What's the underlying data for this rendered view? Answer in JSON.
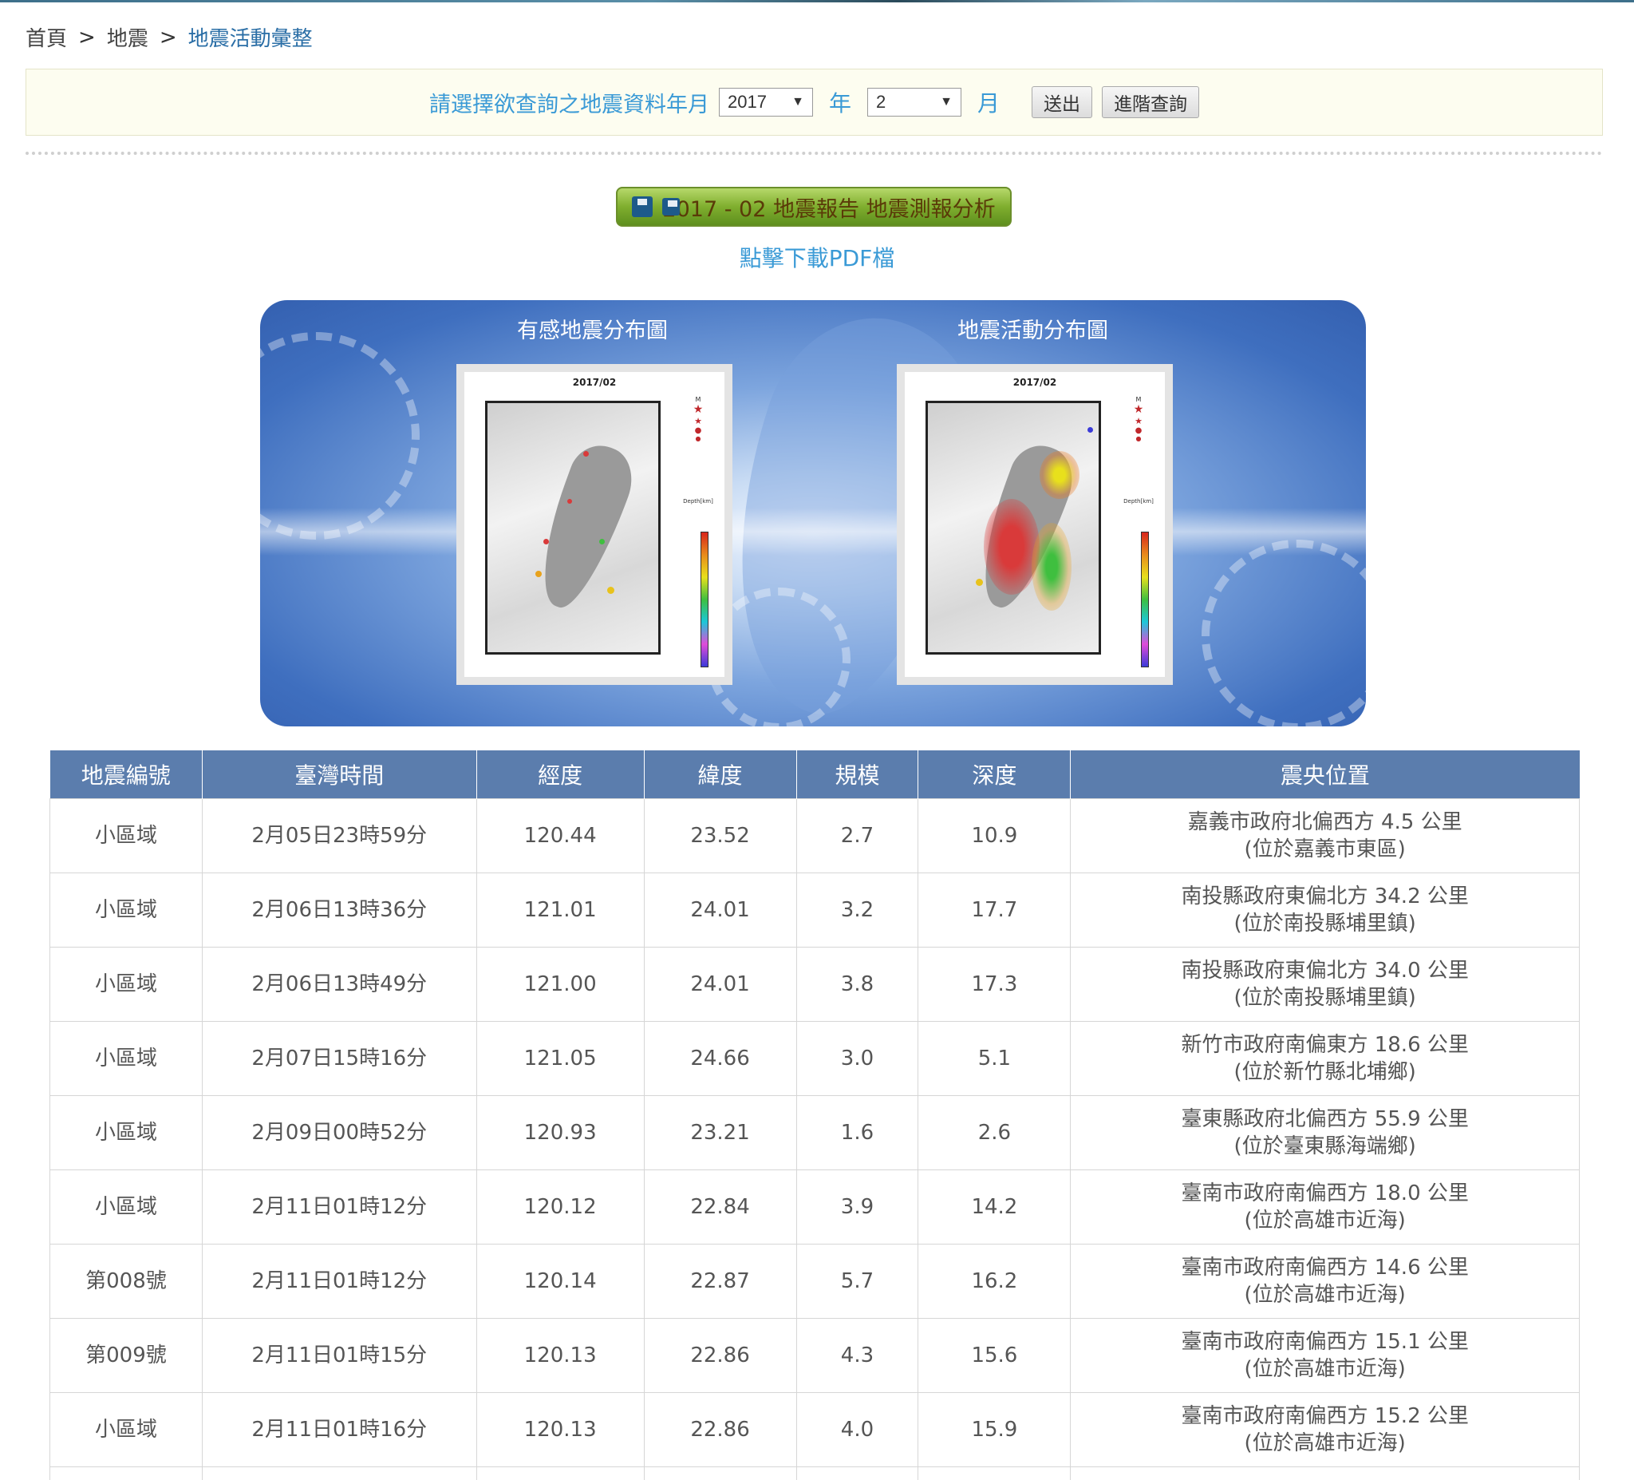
{
  "breadcrumb": {
    "home": "首頁",
    "separator": ">",
    "section": "地震",
    "current": "地震活動彙整"
  },
  "query": {
    "prompt": "請選擇欲查詢之地震資料年月",
    "year_value": "2017",
    "year_unit": "年",
    "month_value": "2",
    "month_unit": "月",
    "submit_label": "送出",
    "advanced_label": "進階查詢"
  },
  "report": {
    "button_label": "2017 - 02 地震報告 地震測報分析",
    "pdf_link": "點擊下載PDF檔"
  },
  "banner": {
    "left_title": "有感地震分布圖",
    "right_title": "地震活動分布圖",
    "left_map_date": "2017/02",
    "right_map_date": "2017/02",
    "legend_title": "M",
    "depth_label": "Depth[km]"
  },
  "table": {
    "headers": [
      "地震編號",
      "臺灣時間",
      "經度",
      "緯度",
      "規模",
      "深度",
      "震央位置"
    ],
    "rows": [
      {
        "id": "小區域",
        "time": "2月05日23時59分",
        "lon": "120.44",
        "lat": "23.52",
        "mag": "2.7",
        "depth": "10.9",
        "loc1": "嘉義市政府北偏西方 4.5 公里",
        "loc2": "(位於嘉義市東區)"
      },
      {
        "id": "小區域",
        "time": "2月06日13時36分",
        "lon": "121.01",
        "lat": "24.01",
        "mag": "3.2",
        "depth": "17.7",
        "loc1": "南投縣政府東偏北方 34.2 公里",
        "loc2": "(位於南投縣埔里鎮)"
      },
      {
        "id": "小區域",
        "time": "2月06日13時49分",
        "lon": "121.00",
        "lat": "24.01",
        "mag": "3.8",
        "depth": "17.3",
        "loc1": "南投縣政府東偏北方 34.0 公里",
        "loc2": "(位於南投縣埔里鎮)"
      },
      {
        "id": "小區域",
        "time": "2月07日15時16分",
        "lon": "121.05",
        "lat": "24.66",
        "mag": "3.0",
        "depth": "5.1",
        "loc1": "新竹市政府南偏東方 18.6 公里",
        "loc2": "(位於新竹縣北埔鄉)"
      },
      {
        "id": "小區域",
        "time": "2月09日00時52分",
        "lon": "120.93",
        "lat": "23.21",
        "mag": "1.6",
        "depth": "2.6",
        "loc1": "臺東縣政府北偏西方 55.9 公里",
        "loc2": "(位於臺東縣海端鄉)"
      },
      {
        "id": "小區域",
        "time": "2月11日01時12分",
        "lon": "120.12",
        "lat": "22.84",
        "mag": "3.9",
        "depth": "14.2",
        "loc1": "臺南市政府南偏西方 18.0 公里",
        "loc2": "(位於高雄市近海)"
      },
      {
        "id": "第008號",
        "time": "2月11日01時12分",
        "lon": "120.14",
        "lat": "22.87",
        "mag": "5.7",
        "depth": "16.2",
        "loc1": "臺南市政府南偏西方 14.6 公里",
        "loc2": "(位於高雄市近海)"
      },
      {
        "id": "第009號",
        "time": "2月11日01時15分",
        "lon": "120.13",
        "lat": "22.86",
        "mag": "4.3",
        "depth": "15.6",
        "loc1": "臺南市政府南偏西方 15.1 公里",
        "loc2": "(位於高雄市近海)"
      },
      {
        "id": "小區域",
        "time": "2月11日01時16分",
        "lon": "120.13",
        "lat": "22.86",
        "mag": "4.0",
        "depth": "15.9",
        "loc1": "臺南市政府南偏西方 15.2 公里",
        "loc2": "(位於高雄市近海)"
      }
    ]
  },
  "colors": {
    "accent_blue": "#3a9ad6",
    "header_blue": "#5b7dad",
    "report_green": "#7fae2e"
  }
}
